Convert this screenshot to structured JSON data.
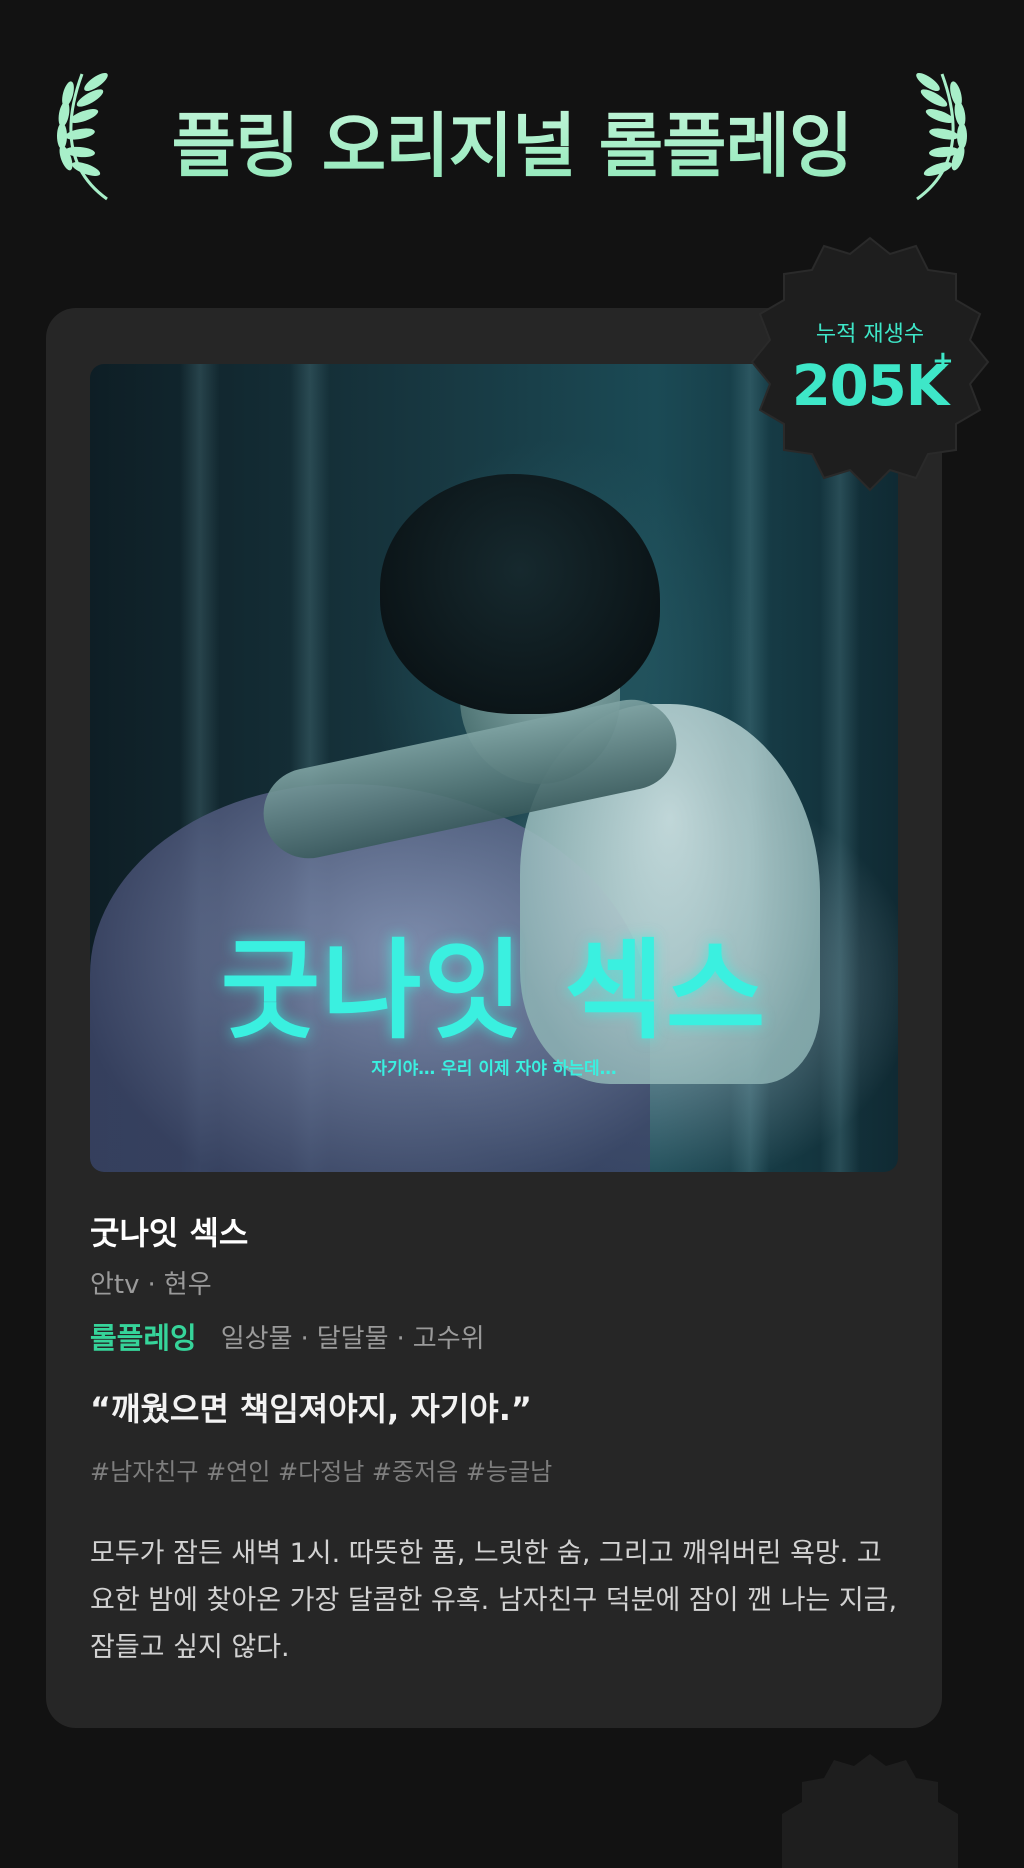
{
  "header": {
    "title": "플링 오리지널 롤플레잉"
  },
  "badge": {
    "label": "누적 재생수",
    "value": "205K",
    "suffix": "+"
  },
  "poster": {
    "title": "굿나잇 섹스",
    "subtitle": "자기야… 우리 이제 자야 하는데…"
  },
  "work": {
    "title": "굿나잇 섹스",
    "creators": [
      "안tv",
      "현우"
    ],
    "genre": "롤플레잉",
    "categories": [
      "일상물",
      "달달물",
      "고수위"
    ],
    "quote": "“깨웠으면 책임져야지, 자기야.”",
    "hashtags": "#남자친구 #연인 #다정남 #중저음 #능글남",
    "description": "모두가 잠든 새벽 1시. 따뜻한 품, 느릿한 숨, 그리고 깨워버린 욕망. 고요한 밤에 찾아온 가장 달콤한 유혹. 남자친구 덕분에 잠이 깬 나는 지금, 잠들고 싶지 않다."
  },
  "colors": {
    "accent_mint": "#36d49a",
    "badge_teal": "#3ee7c8",
    "title_green": "#a8efc9",
    "background": "#121212",
    "card": "#262626"
  },
  "icons": {
    "laurel_left": "laurel-left-icon",
    "laurel_right": "laurel-right-icon"
  }
}
